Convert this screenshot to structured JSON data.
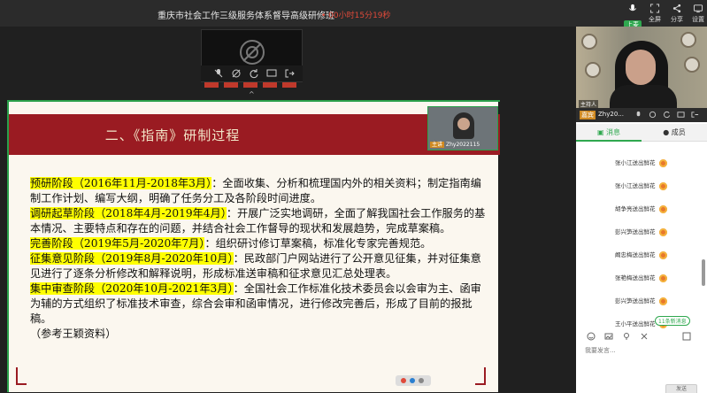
{
  "header": {
    "title": "重庆市社会工作三级服务体系督导高级研修班",
    "timer": "• 00小时15分19秒",
    "actions": [
      {
        "label": "上麦",
        "icon": "mic-icon"
      },
      {
        "label": "全屏",
        "icon": "fullscreen-icon"
      },
      {
        "label": "分享",
        "icon": "share-icon"
      },
      {
        "label": "设置",
        "icon": "settings-icon"
      }
    ]
  },
  "preview": {
    "collapse_arrow": "^"
  },
  "slide": {
    "heading": "二、《指南》研制过程",
    "paragraphs": [
      {
        "highlight": "预研阶段（2016年11月-2018年3月）",
        "text": "：全面收集、分析和梳理国内外的相关资料；制定指南编制工作计划、编写大纲，明确了任务分工及各阶段时间进度。"
      },
      {
        "highlight": "调研起草阶段（2018年4月-2019年4月）",
        "text": "：开展广泛实地调研，全面了解我国社会工作服务的基本情况、主要特点和存在的问题，并结合社会工作督导的现状和发展趋势，完成草案稿。"
      },
      {
        "highlight": "完善阶段（2019年5月-2020年7月）",
        "text": "：组织研讨修订草案稿，标准化专家完善规范。"
      },
      {
        "highlight": "征集意见阶段（2019年8月-2020年10月）",
        "text": "：民政部门户网站进行了公开意见征集，并对征集意见进行了逐条分析修改和解释说明，形成标准送审稿和征求意见汇总处理表。"
      },
      {
        "highlight": "集中审查阶段（2020年10月-2021年3月）",
        "text": "：全国社会工作标准化技术委员会以会审为主、函审为辅的方式组织了标准技术审查，综合会审和函审情况，进行修改完善后，形成了目前的报批稿。"
      }
    ],
    "reference": "（参考王颖资料）"
  },
  "mini_cam": {
    "host_tag": "主讲",
    "name": "Zhy2022115"
  },
  "right_panel": {
    "video_label": "主持人",
    "namebar": {
      "host_tag": "嘉宾",
      "name": "Zhy20..."
    },
    "tabs": [
      {
        "label": "消息",
        "active": true
      },
      {
        "label": "成员",
        "active": false
      }
    ],
    "messages": [
      {
        "text": "张小江送出鲜花"
      },
      {
        "text": "张小江送出鲜花"
      },
      {
        "text": "胡争亮送出鲜花"
      },
      {
        "text": "彭兴笋送出鲜花"
      },
      {
        "text": "阚忠梅送出鲜花"
      },
      {
        "text": "张艳梅送出鲜花"
      },
      {
        "text": "彭兴笋送出鲜花"
      },
      {
        "text": "王小平送出鲜花"
      }
    ],
    "new_messages": "11条新消息",
    "input_placeholder": "我要发言...",
    "send_label": "发送"
  },
  "colors": {
    "accent": "#2fa84f",
    "timer": "#e04a3a",
    "slide_band": "#9a1b22",
    "highlight": "#ffff00"
  }
}
